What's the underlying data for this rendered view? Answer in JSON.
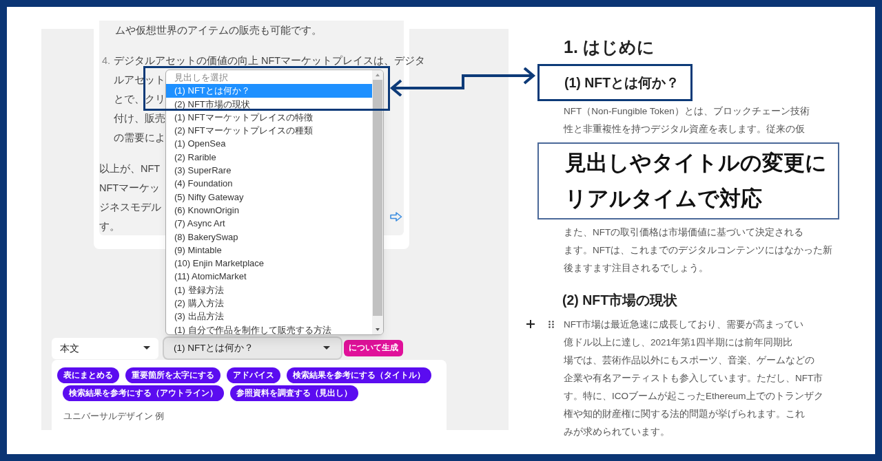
{
  "editor_panel": {
    "top_line": "ムや仮想世界のアイテムの販売も可能です。",
    "list_item": {
      "marker": "4.",
      "lines": [
        "デジタルアセットの価値の向上 NFTマーケットプレイスは、デジタ",
        "ルアセット",
        "とで、クリ",
        "付け、販売",
        "の需要によ"
      ]
    },
    "summary_lines": [
      "以上が、NFT",
      "NFTマーケッ",
      "ジネスモデル",
      "す。"
    ]
  },
  "heading_dropdown": {
    "header_option": "見出しを選択",
    "options": [
      {
        "label": "(1) NFTとは何か？",
        "selected": true
      },
      {
        "label": "(2) NFT市場の現状",
        "selected": false
      },
      {
        "label": "(1) NFTマーケットプレイスの特徴",
        "selected": false
      },
      {
        "label": "(2) NFTマーケットプレイスの種類",
        "selected": false
      },
      {
        "label": "(1) OpenSea",
        "selected": false
      },
      {
        "label": "(2) Rarible",
        "selected": false
      },
      {
        "label": "(3) SuperRare",
        "selected": false
      },
      {
        "label": "(4) Foundation",
        "selected": false
      },
      {
        "label": "(5) Nifty Gateway",
        "selected": false
      },
      {
        "label": "(6) KnownOrigin",
        "selected": false
      },
      {
        "label": "(7) Async Art",
        "selected": false
      },
      {
        "label": "(8) BakerySwap",
        "selected": false
      },
      {
        "label": "(9) Mintable",
        "selected": false
      },
      {
        "label": "(10) Enjin Marketplace",
        "selected": false
      },
      {
        "label": "(11) AtomicMarket",
        "selected": false
      },
      {
        "label": "(1) 登録方法",
        "selected": false
      },
      {
        "label": "(2) 購入方法",
        "selected": false
      },
      {
        "label": "(3) 出品方法",
        "selected": false
      },
      {
        "label": "(1) 自分で作品を制作して販売する方法",
        "selected": false
      }
    ]
  },
  "toolbar": {
    "block_type": "本文",
    "heading_select": "(1) NFTとは何か？",
    "generate_button": "について生成"
  },
  "action_chips": [
    [
      "表にまとめる",
      "重要箇所を太字にする",
      "アドバイス",
      "検索結果を参考にする（タイトル）"
    ],
    [
      "検索結果を参考にする（アウトライン）",
      "参照資料を調査する（見出し）"
    ]
  ],
  "prompt_text": "ユニバーサルデザイン 例",
  "document": [
    {
      "kind": "h1",
      "text": "1. はじめに",
      "highlighted": false
    },
    {
      "kind": "h2",
      "text": "(1) NFTとは何か？",
      "highlighted": true
    },
    {
      "kind": "p",
      "lines": [
        "NFT（Non-Fungible Token）とは、ブロックチェーン技術",
        "性と非重複性を持つデジタル資産を表します。従来の仮"
      ]
    },
    {
      "kind": "callout",
      "text": "見出しやタイトルの変更にリアルタイムで対応"
    },
    {
      "kind": "p",
      "lines": [
        "また、NFTの取引価格は市場価値に基づいて決定される",
        "ます。NFTは、これまでのデジタルコンテンツにはなかった新",
        "後ますます注目されるでしょう。"
      ]
    },
    {
      "kind": "h2",
      "text": "(2) NFT市場の現状",
      "highlighted": false
    },
    {
      "kind": "p",
      "handles": true,
      "lines": [
        "NFT市場は最近急速に成長しており、需要が高まってい",
        "億ドル以上に達し、2021年第1四半期には前年同期比",
        "場では、芸術作品以外にもスポーツ、音楽、ゲームなどの",
        "企業や有名アーティストも参入しています。ただし、NFT市",
        "す。特に、ICOブームが起こったEthereum上でのトランザク",
        "権や知的財産権に関する法的問題が挙げられます。これ",
        "みが求められています。"
      ]
    }
  ]
}
